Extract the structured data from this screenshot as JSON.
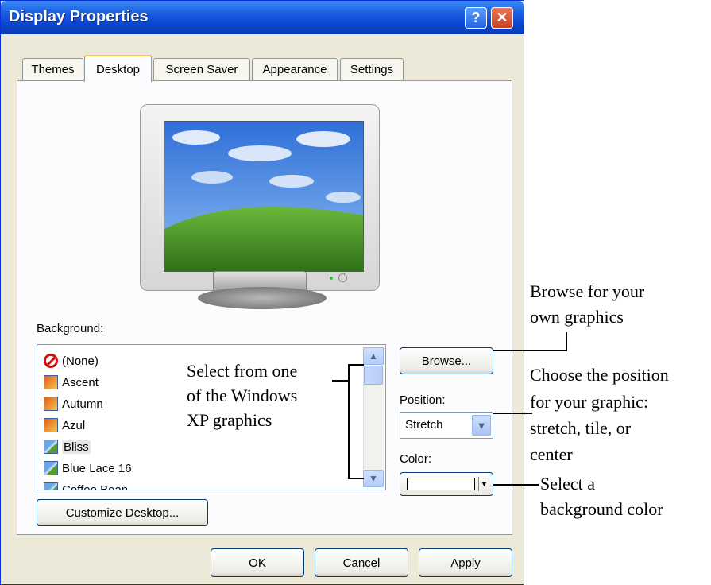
{
  "window": {
    "title": "Display Properties",
    "help_glyph": "?",
    "close_glyph": "✕"
  },
  "tabs": [
    {
      "label": "Themes"
    },
    {
      "label": "Desktop",
      "active": true
    },
    {
      "label": "Screen Saver"
    },
    {
      "label": "Appearance"
    },
    {
      "label": "Settings"
    }
  ],
  "background": {
    "label": "Background:",
    "items": [
      {
        "label": "(None)",
        "icon": "none-icon"
      },
      {
        "label": "Ascent",
        "icon": "image-icon"
      },
      {
        "label": "Autumn",
        "icon": "image-icon"
      },
      {
        "label": "Azul",
        "icon": "image-icon"
      },
      {
        "label": "Bliss",
        "icon": "bliss-icon",
        "selected": true
      },
      {
        "label": "Blue Lace 16",
        "icon": "bliss-icon"
      },
      {
        "label": "Coffee Bean",
        "icon": "bliss-icon"
      }
    ],
    "scroll_up_glyph": "▲",
    "scroll_down_glyph": "▼"
  },
  "browse": {
    "label": "Browse..."
  },
  "position": {
    "label": "Position:",
    "value": "Stretch",
    "arrow_glyph": "▼"
  },
  "color": {
    "label": "Color:",
    "value": "#ffffff",
    "arrow_glyph": "▼"
  },
  "customize": {
    "label": "Customize Desktop..."
  },
  "buttons": {
    "ok": "OK",
    "cancel": "Cancel",
    "apply": "Apply"
  },
  "annotations": {
    "select_from": [
      "Select from one",
      "of the Windows",
      "XP graphics"
    ],
    "browse": [
      "Browse for your",
      "own graphics"
    ],
    "position": [
      "Choose the position",
      "for your graphic:",
      "stretch, tile, or",
      "center"
    ],
    "color": [
      "Select a",
      "background color"
    ]
  }
}
